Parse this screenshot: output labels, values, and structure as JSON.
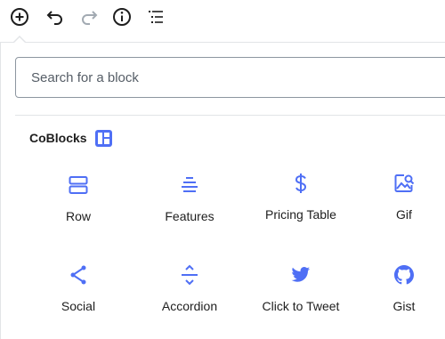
{
  "toolbar": {
    "buttons": [
      {
        "name": "add-block-button",
        "icon": "plus-circle-icon"
      },
      {
        "name": "undo-button",
        "icon": "undo-icon"
      },
      {
        "name": "redo-button",
        "icon": "redo-icon"
      },
      {
        "name": "info-button",
        "icon": "info-icon"
      },
      {
        "name": "outline-button",
        "icon": "list-outline-icon"
      }
    ]
  },
  "search": {
    "placeholder": "Search for a block",
    "value": ""
  },
  "category": {
    "title": "CoBlocks",
    "logo_icon": "coblocks-logo-icon"
  },
  "blocks": [
    {
      "label": "Row",
      "icon": "row-icon"
    },
    {
      "label": "Features",
      "icon": "features-icon"
    },
    {
      "label": "Pricing Table",
      "icon": "dollar-icon"
    },
    {
      "label": "Gif",
      "icon": "gif-icon"
    },
    {
      "label": "Social",
      "icon": "share-icon"
    },
    {
      "label": "Accordion",
      "icon": "accordion-icon"
    },
    {
      "label": "Click to Tweet",
      "icon": "twitter-icon"
    },
    {
      "label": "Gist",
      "icon": "github-icon"
    }
  ],
  "colors": {
    "accent": "#4f6ff5",
    "toolbar_icon": "#1e1e1e",
    "disabled_icon": "#a2aab2",
    "border": "#8d96a0",
    "divider": "#e2e4e7"
  }
}
